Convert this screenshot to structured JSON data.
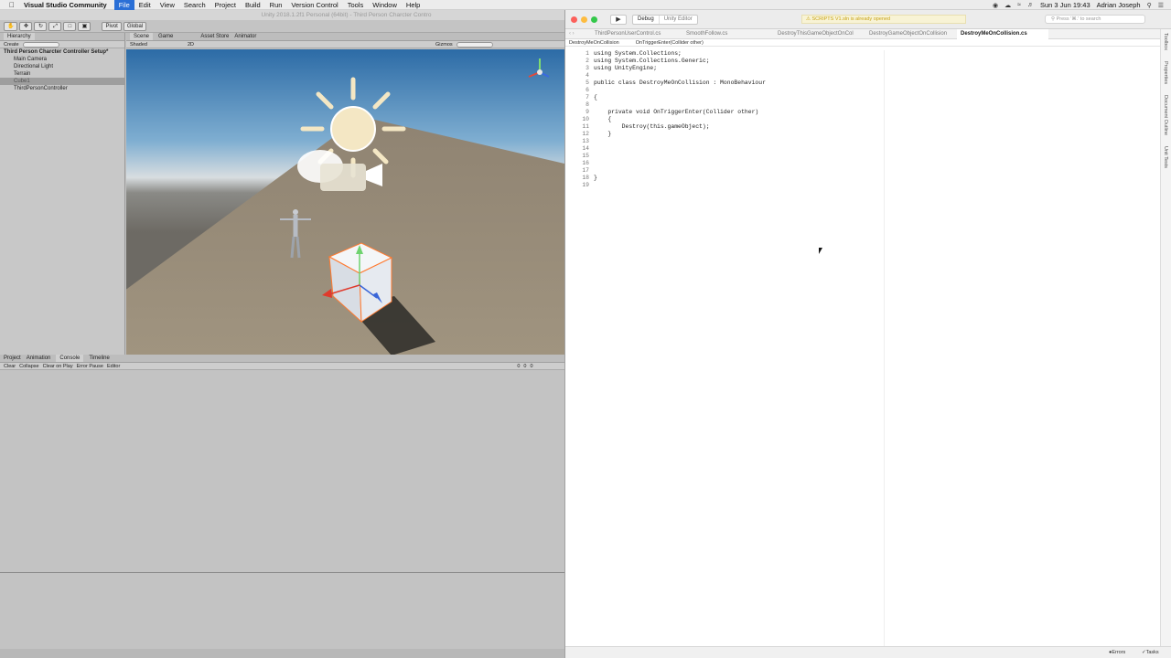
{
  "menubar": {
    "app_name": "Visual Studio Community",
    "items": [
      "File",
      "Edit",
      "View",
      "Search",
      "Project",
      "Build",
      "Run",
      "Version Control",
      "Tools",
      "Window",
      "Help"
    ],
    "active_item": "File",
    "datetime": "Sun 3 Jun 19:43",
    "user": "Adrian Joseph"
  },
  "unity": {
    "window_title": "Unity 2018.1.2f1 Personal (64bit) - Third Person Charcter Contro",
    "toolbar": {
      "pivot": "Pivot",
      "global": "Global"
    },
    "hierarchy": {
      "tab": "Hierarchy",
      "create": "Create",
      "search_placeholder": "All",
      "root": "Third Person Charcter Controller Setup*",
      "items": [
        "Main Camera",
        "Directional Light",
        "Terrain",
        "Cube1",
        "ThirdPersonController"
      ],
      "selected": "Cube1"
    },
    "scene": {
      "tabs": [
        "Scene",
        "Game",
        "Asset Store",
        "Animator"
      ],
      "shading": "Shaded",
      "mode": "2D",
      "gizmos": "Gizmos",
      "search_placeholder": "All"
    },
    "bottom": {
      "tabs": [
        "Project",
        "Animation",
        "Console",
        "Timeline"
      ],
      "active_tab": "Console",
      "buttons": [
        "Clear",
        "Collapse",
        "Clear on Play",
        "Error Pause",
        "Editor"
      ],
      "counts": [
        "0",
        "0",
        "0"
      ]
    }
  },
  "vs": {
    "config": "Debug",
    "target": "Unity Editor",
    "notice": "SCRIPTS V1.sln is already opened",
    "search_placeholder": "Press '⌘.' to search",
    "tabs": [
      "ThirdPersonUserControl.cs",
      "SmoothFollow.cs",
      "DestroyThisGameObjectOnCol",
      "DestroyGameObjectOnCollision",
      "DestroyMeOnCollision.cs"
    ],
    "active_tab": "DestroyMeOnCollision.cs",
    "path": {
      "class": "DestroyMeOnCollision",
      "method": "OnTriggerEnter(Collider other)"
    },
    "code_lines": [
      "using System.Collections;",
      "using System.Collections.Generic;",
      "using UnityEngine;",
      "",
      "public class DestroyMeOnCollision : MonoBehaviour",
      "",
      "{",
      "",
      "    private void OnTriggerEnter(Collider other)",
      "    {",
      "        Destroy(this.gameObject);",
      "    }",
      "",
      "",
      "",
      "",
      "",
      "}",
      ""
    ],
    "sidebar": [
      "Toolbox",
      "Properties",
      "Document Outline",
      "Unit Tests"
    ],
    "status": {
      "errors": "Errors",
      "tasks": "Tasks"
    }
  }
}
